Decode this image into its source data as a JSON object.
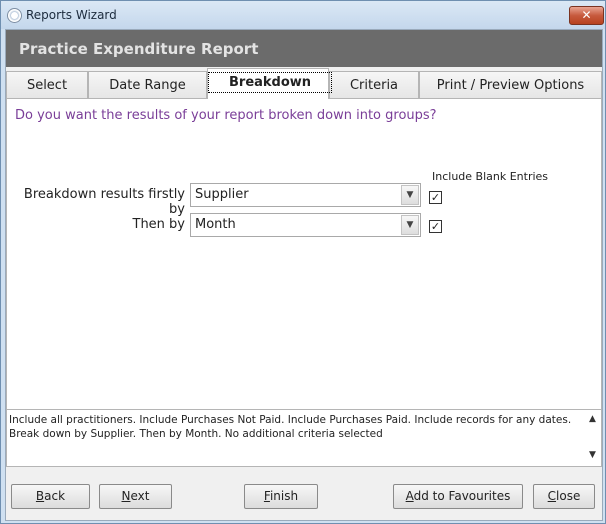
{
  "window": {
    "title": "Reports Wizard",
    "close_label": "✕"
  },
  "header": {
    "report_title": "Practice Expenditure Report"
  },
  "tabs": [
    {
      "label": "Select"
    },
    {
      "label": "Date Range"
    },
    {
      "label": "Breakdown"
    },
    {
      "label": "Criteria"
    },
    {
      "label": "Print / Preview Options"
    }
  ],
  "active_tab": "Breakdown",
  "breakdown": {
    "question": "Do you want the results of your report broken down into groups?",
    "include_blank_header": "Include Blank Entries",
    "first_label": "Breakdown results firstly by",
    "first_value": "Supplier",
    "first_include_blank": true,
    "then_label": "Then by",
    "then_value": "Month",
    "then_include_blank": true
  },
  "summary": {
    "text": "Include all practitioners. Include Purchases Not Paid. Include Purchases Paid. Include records for any dates. Break down by Supplier. Then by Month. No additional criteria selected"
  },
  "buttons": {
    "back": {
      "first": "B",
      "rest": "ack"
    },
    "next": {
      "first": "N",
      "rest": "ext"
    },
    "finish": {
      "first": "F",
      "rest": "inish"
    },
    "favourites": {
      "first": "A",
      "rest": "dd to Favourites"
    },
    "close": {
      "first": "C",
      "rest": "lose"
    }
  }
}
